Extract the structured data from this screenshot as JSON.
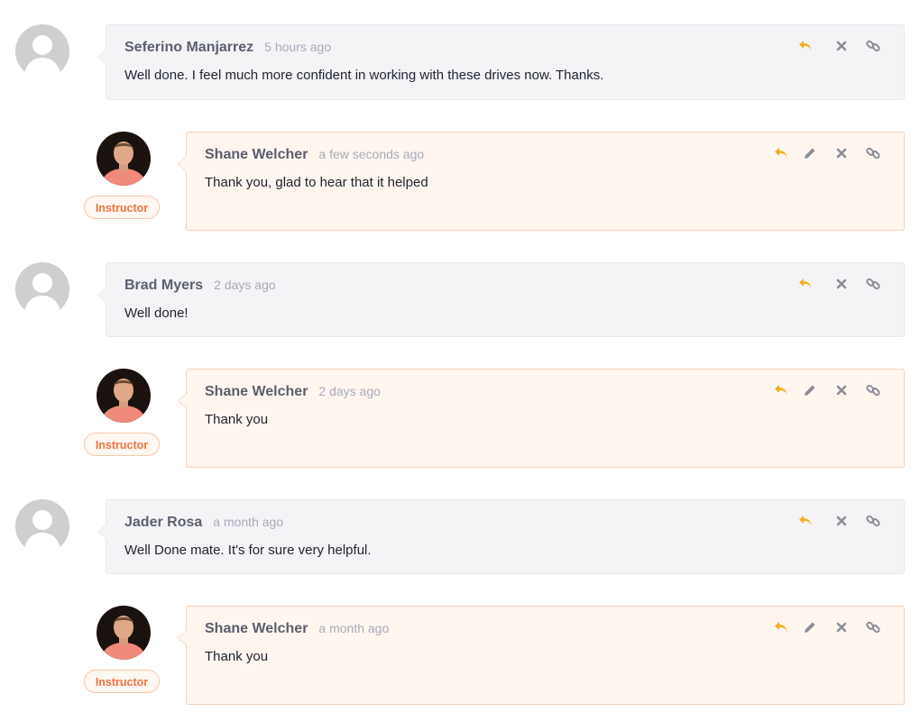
{
  "colors": {
    "reply": "#f2b01e",
    "icon": "#8b8e99",
    "badge_text": "#ee7340",
    "instructor_bg": "#fff6ef"
  },
  "comments": [
    {
      "author": "Seferino Manjarrez",
      "time": "5 hours ago",
      "text": "Well done. I feel much more confident in working with these drives now. Thanks."
    },
    {
      "author": "Shane Welcher",
      "time": "a few seconds ago",
      "text": "Thank you, glad to hear that it helped",
      "badge": "Instructor"
    },
    {
      "author": "Brad Myers",
      "time": "2 days ago",
      "text": "Well done!"
    },
    {
      "author": "Shane Welcher",
      "time": "2 days ago",
      "text": "Thank you",
      "badge": "Instructor"
    },
    {
      "author": "Jader Rosa",
      "time": "a month ago",
      "text": "Well Done mate. It's for sure very helpful."
    },
    {
      "author": "Shane Welcher",
      "time": "a month ago",
      "text": "Thank you",
      "badge": "Instructor"
    }
  ]
}
